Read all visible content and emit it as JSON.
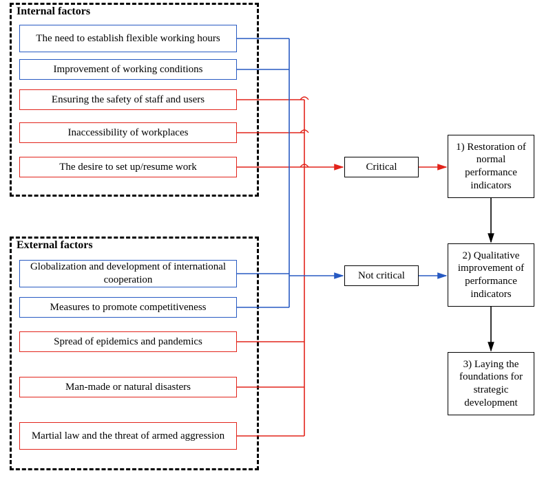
{
  "groups": {
    "internal_title": "Internal factors",
    "external_title": "External factors"
  },
  "internal": [
    "The need to establish flexible working hours",
    "Improvement of working conditions",
    "Ensuring the safety of staff and users",
    "Inaccessibility of workplaces",
    "The desire to set up/resume work"
  ],
  "external": [
    "Globalization and development of international cooperation",
    "Measures to promote competitiveness",
    "Spread of epidemics and pandemics",
    "Man-made or natural disasters",
    "Martial law and the threat of armed aggression"
  ],
  "mid": {
    "critical": "Critical",
    "not_critical": "Not critical"
  },
  "outcomes": {
    "o1": "1) Restoration of normal performance indicators",
    "o2": "2) Qualitative improvement of performance indicators",
    "o3": "3) Laying the foundations for strategic development"
  },
  "colors": {
    "blue": "#2659c2",
    "red": "#e2231a",
    "black": "#000000"
  }
}
